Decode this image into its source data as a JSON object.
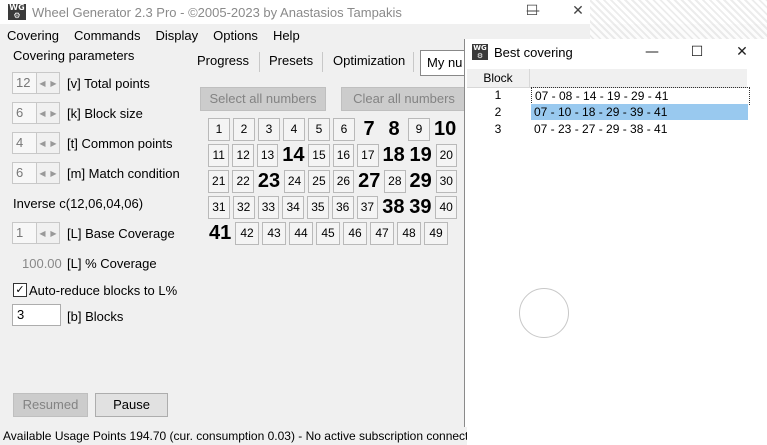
{
  "main_window": {
    "title": "Wheel Generator 2.3 Pro  - ©2005-2023 by Anastasios Tampakis",
    "icon_name": "wheel-generator-icon",
    "controls": {
      "minimize": "—",
      "maximize": "☐",
      "close": "✕"
    }
  },
  "menu": [
    "Covering",
    "Commands",
    "Display",
    "Options",
    "Help"
  ],
  "params": {
    "group_label": "Covering parameters",
    "total_points": {
      "value": "12",
      "label": "[v] Total points"
    },
    "block_size": {
      "value": "6",
      "label": "[k] Block size"
    },
    "common_points": {
      "value": "4",
      "label": "[t] Common points"
    },
    "match_condition": {
      "value": "6",
      "label": "[m] Match condition"
    },
    "inverse": "Inverse c(12,06,04,06)",
    "base_coverage": {
      "value": "1",
      "label": "[L] Base Coverage"
    },
    "pct_coverage": {
      "value": "100.00",
      "label": "[L] % Coverage"
    },
    "auto_reduce": {
      "label": "Auto-reduce blocks to L%",
      "checked": "✓"
    },
    "blocks": {
      "value": "3",
      "label": "[b] Blocks"
    },
    "resumed_label": "Resumed",
    "pause_label": "Pause"
  },
  "tabs": [
    "Progress",
    "Presets",
    "Optimization",
    "My nu"
  ],
  "buttons": {
    "select_all": "Select all numbers",
    "clear_all": "Clear all numbers"
  },
  "numbers": [
    [
      "1",
      "2",
      "3",
      "4",
      "5",
      "6",
      "7",
      "8",
      "9",
      "10"
    ],
    [
      "11",
      "12",
      "13",
      "14",
      "15",
      "16",
      "17",
      "18",
      "19",
      "20"
    ],
    [
      "21",
      "22",
      "23",
      "24",
      "25",
      "26",
      "27",
      "28",
      "29",
      "30"
    ],
    [
      "31",
      "32",
      "33",
      "34",
      "35",
      "36",
      "37",
      "38",
      "39",
      "40"
    ],
    [
      "41",
      "42",
      "43",
      "44",
      "45",
      "46",
      "47",
      "48",
      "49"
    ]
  ],
  "selected_numbers": [
    "7",
    "8",
    "10",
    "14",
    "18",
    "19",
    "23",
    "27",
    "29",
    "38",
    "39",
    "41"
  ],
  "best_covering": {
    "title": "Best covering",
    "column_header": "Block",
    "rows": [
      {
        "n": "1",
        "value": "07 - 08 - 14 - 19 - 29 - 41"
      },
      {
        "n": "2",
        "value": "07 - 10 - 18 - 29 - 39 - 41"
      },
      {
        "n": "3",
        "value": "07 - 23 - 27 - 29 - 38 - 41"
      }
    ]
  },
  "status": "Available Usage Points 194.70 (cur. consumption 0.03) - No active subscription connect"
}
